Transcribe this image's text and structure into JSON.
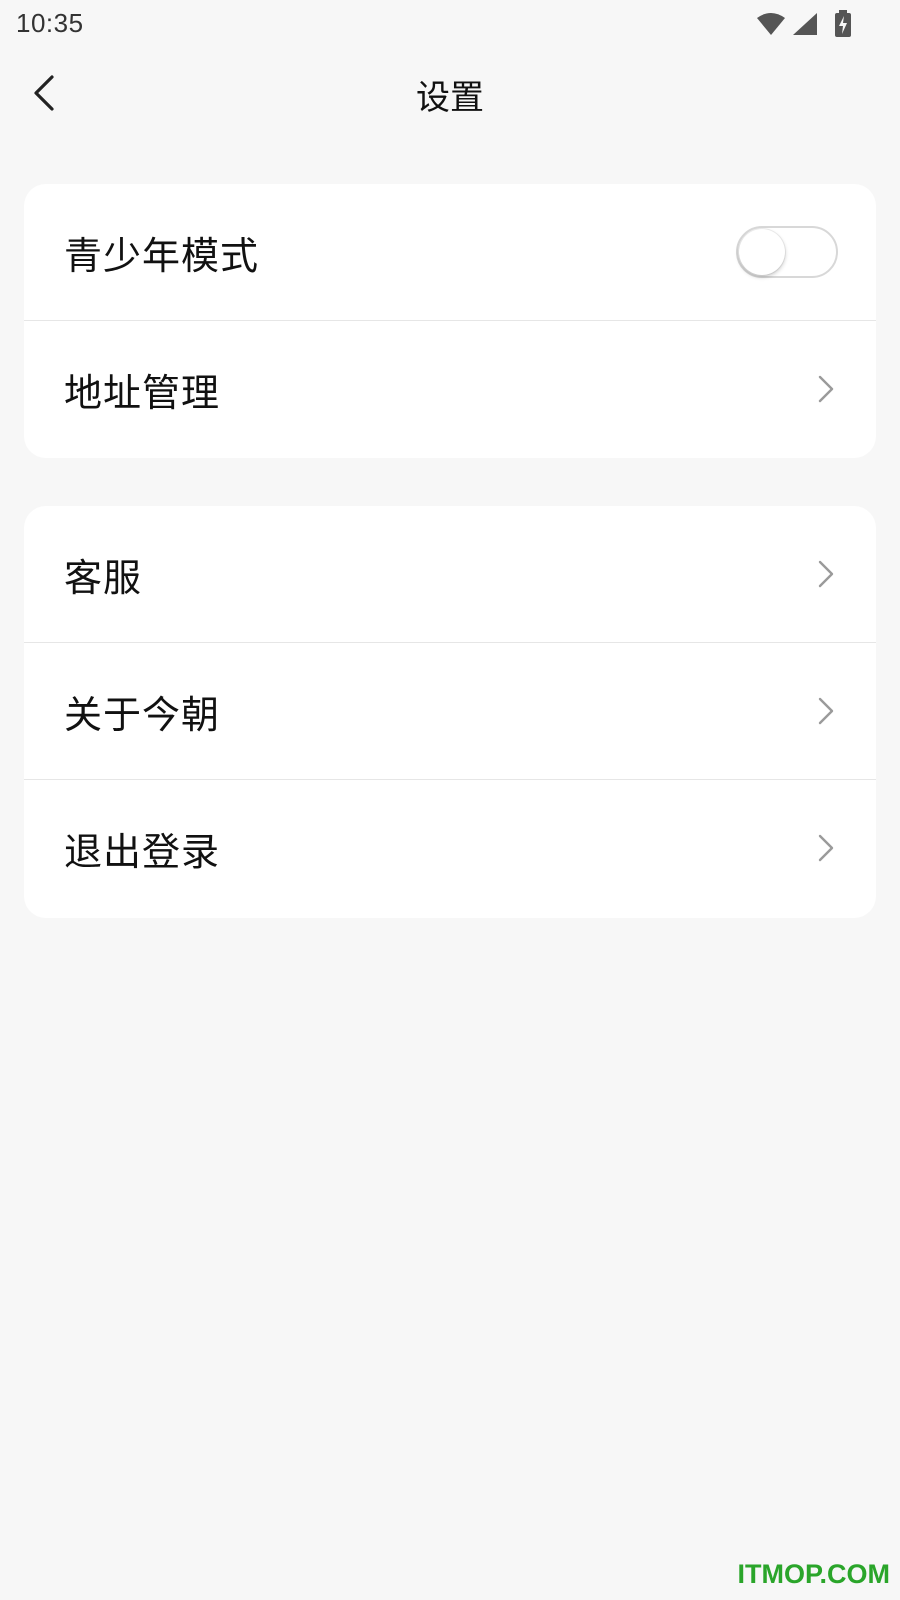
{
  "status_bar": {
    "time": "10:35",
    "icons": [
      "wifi-icon",
      "signal-icon",
      "battery-charging-icon"
    ]
  },
  "header": {
    "back_icon": "chevron-left-icon",
    "title": "设置"
  },
  "groups": [
    {
      "items": [
        {
          "label": "青少年模式",
          "control": "toggle",
          "toggle_on": false
        },
        {
          "label": "地址管理",
          "control": "chevron"
        }
      ]
    },
    {
      "items": [
        {
          "label": "客服",
          "control": "chevron"
        },
        {
          "label": "关于今朝",
          "control": "chevron"
        },
        {
          "label": "退出登录",
          "control": "chevron"
        }
      ]
    }
  ],
  "watermark": "ITMOP.COM",
  "colors": {
    "background": "#f7f7f7",
    "card": "#ffffff",
    "divider": "#e6e6e6",
    "chevron": "#9a9a9a",
    "watermark": "#2aa52a"
  }
}
